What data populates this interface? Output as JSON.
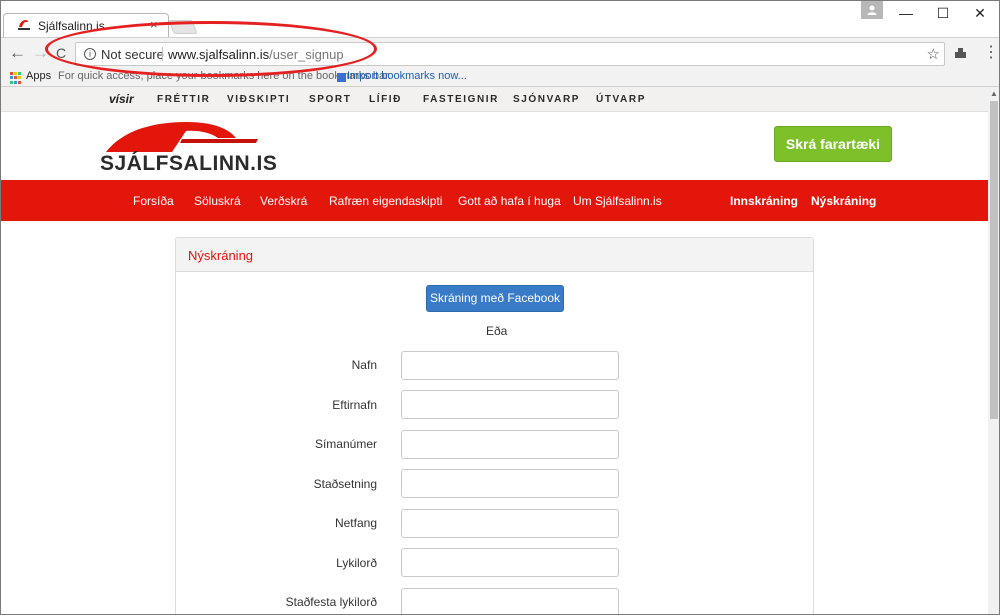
{
  "browser": {
    "tab_title": "Sjálfsalinn.is",
    "tab_close": "×",
    "security_label": "Not secure",
    "url_host": "www.sjalfsalinn.is",
    "url_path": "/user_signup",
    "bookmarks": {
      "apps_label": "Apps",
      "hint": "For quick access, place your bookmarks here on the bookmarks bar.",
      "import_link": "Import bookmarks now..."
    },
    "icons": {
      "back": "←",
      "forward": "→",
      "reload": "C",
      "info": "i",
      "star": "☆",
      "menu": "⋮",
      "minimize": "—",
      "maximize": "☐",
      "close": "✕"
    }
  },
  "site": {
    "top_links": [
      "vísir",
      "FRÉTTIR",
      "VIÐSKIPTI",
      "SPORT",
      "LÍFIÐ",
      "FASTEIGNIR",
      "SJÓNVARP",
      "ÚTVARP"
    ],
    "logo_text": "SJÁLFSALINN.IS",
    "cta_label": "Skrá farartæki",
    "nav": [
      "Forsíða",
      "Söluskrá",
      "Verðskrá",
      "Rafræn eigendaskipti",
      "Gott að hafa í huga",
      "Um Sjálfsalinn.is"
    ],
    "auth": {
      "login": "Innskráning",
      "signup": "Nýskráning"
    },
    "brand_red": "#e3160b",
    "cta_green": "#7dc02a"
  },
  "form": {
    "title": "Nýskráning",
    "facebook_button": "Skráning með Facebook",
    "or_text": "Eða",
    "fields": [
      {
        "label": "Nafn",
        "value": ""
      },
      {
        "label": "Eftirnafn",
        "value": ""
      },
      {
        "label": "Símanúmer",
        "value": ""
      },
      {
        "label": "Staðsetning",
        "value": ""
      },
      {
        "label": "Netfang",
        "value": ""
      },
      {
        "label": "Lykilorð",
        "value": ""
      },
      {
        "label": "Staðfesta lykilorð",
        "value": ""
      }
    ]
  }
}
